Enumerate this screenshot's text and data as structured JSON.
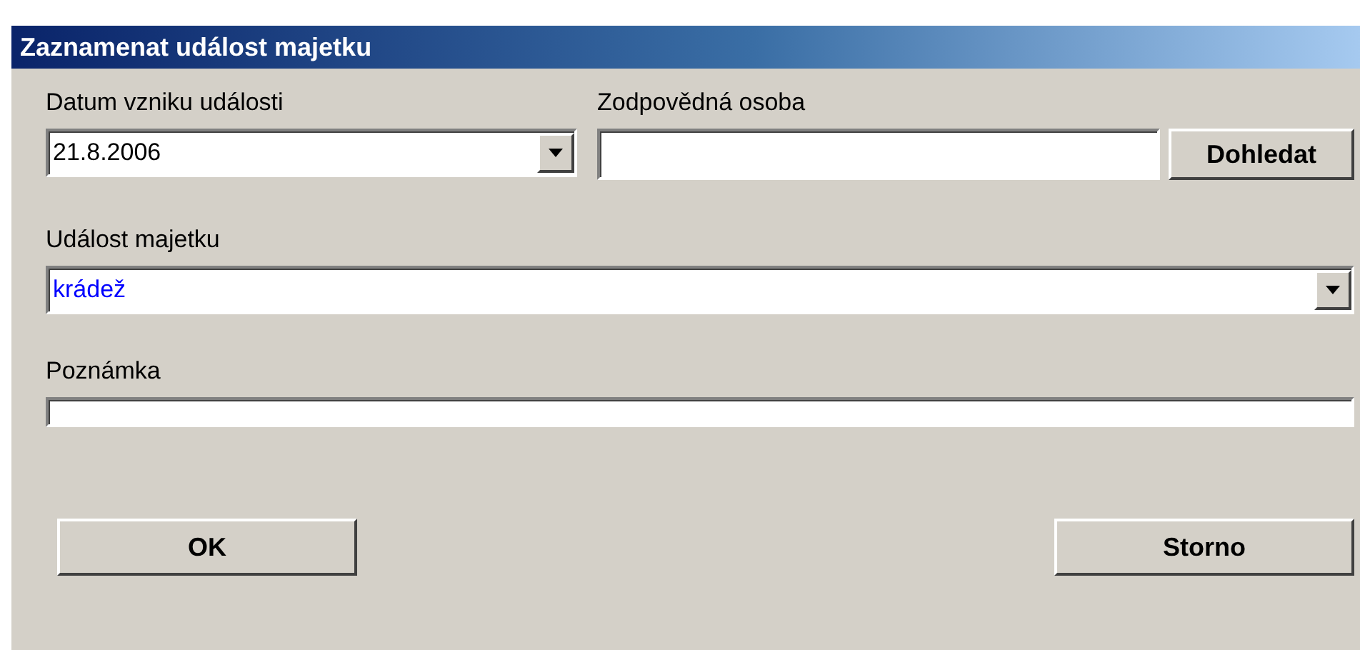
{
  "window": {
    "title": "Zaznamenat událost majetku"
  },
  "date_field": {
    "label": "Datum vzniku události",
    "value": "21.8.2006"
  },
  "person_field": {
    "label": "Zodpovědná osoba",
    "button": "Dohledat"
  },
  "event_field": {
    "label": "Událost majetku",
    "value": "krádež"
  },
  "note_field": {
    "label": "Poznámka"
  },
  "ok_button": {
    "label": "OK"
  },
  "cancel_button": {
    "label": "Storno"
  }
}
